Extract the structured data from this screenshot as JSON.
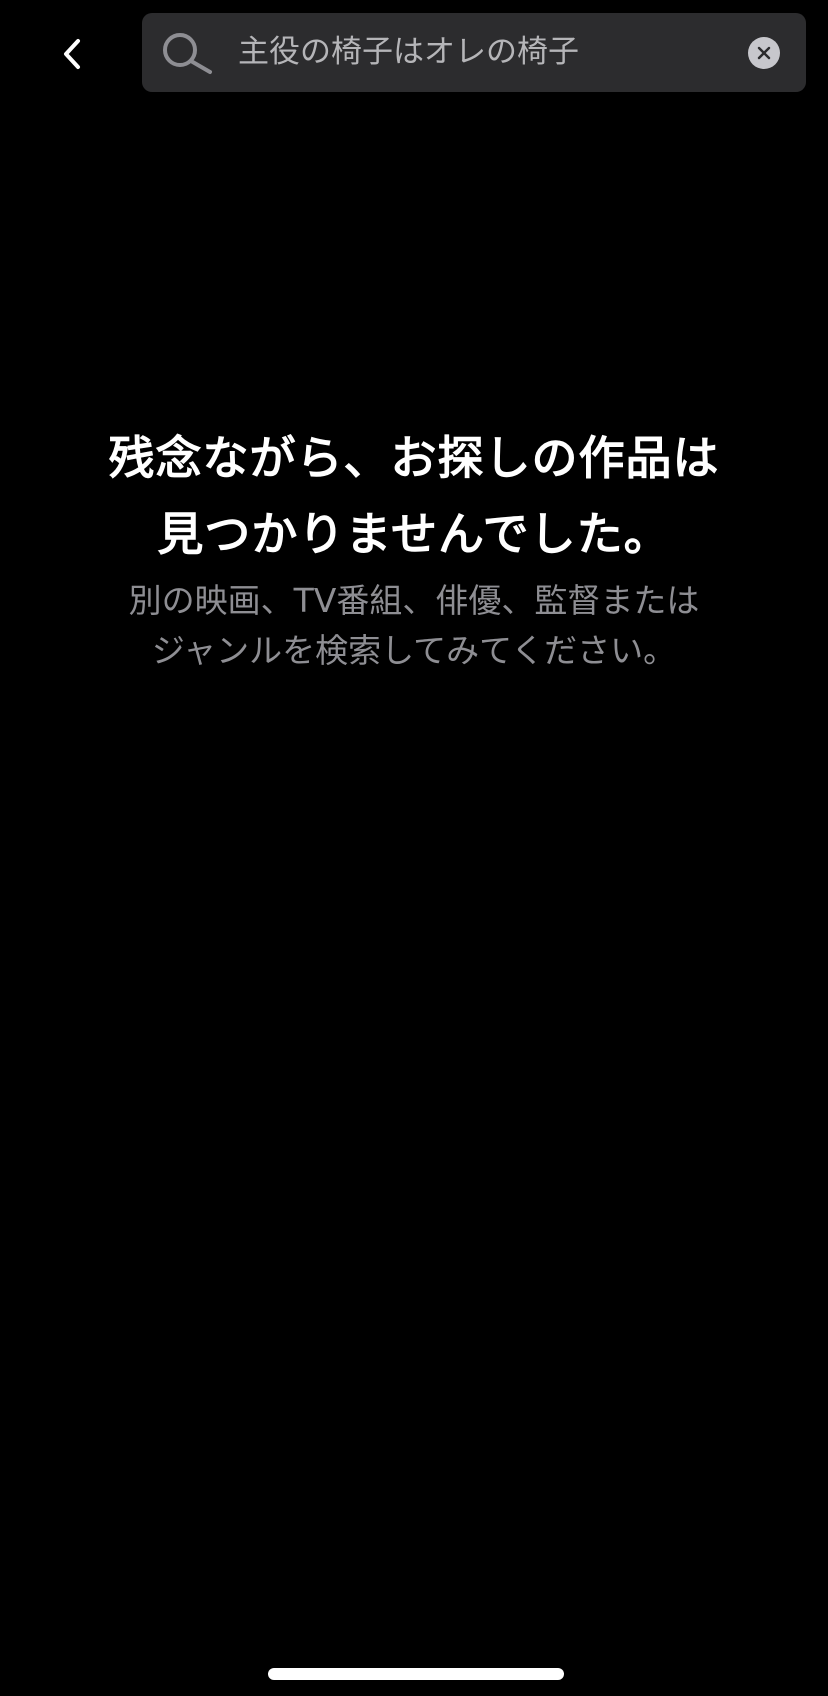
{
  "header": {
    "back_icon": "chevron-left-icon",
    "search": {
      "value": "主役の椅子はオレの椅子",
      "placeholder": "",
      "search_icon": "magnifier-icon",
      "clear_icon": "clear-circle-x-icon"
    }
  },
  "empty_state": {
    "title_line1": "残念ながら、お探しの作品は",
    "title_line2": "見つかりませんでした。",
    "subtitle_line1": "別の映画、TV番組、俳優、監督または",
    "subtitle_line2": "ジャンルを検索してみてください。"
  },
  "colors": {
    "background": "#000000",
    "search_field": "#2c2c2e",
    "title_text": "#ffffff",
    "subtitle_text": "#8e8e93"
  }
}
